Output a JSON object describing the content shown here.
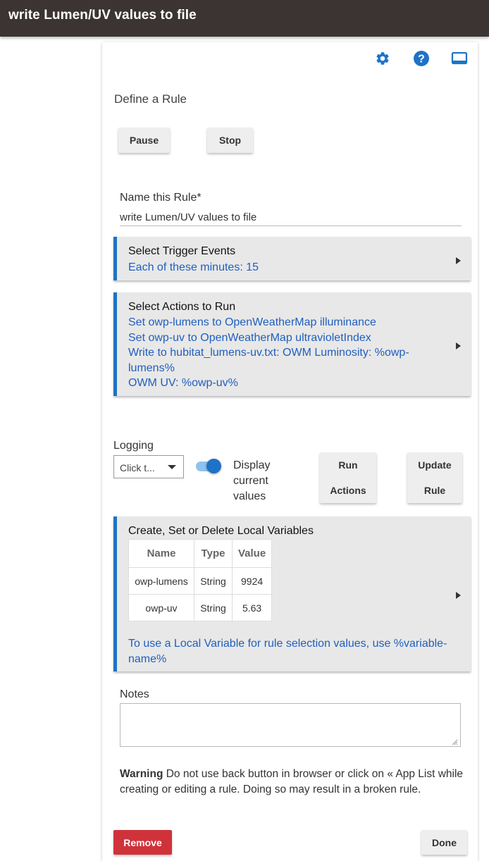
{
  "window": {
    "title": "write Lumen/UV values to file"
  },
  "toolbar": {
    "settings_icon": "gear-icon",
    "help_icon": "help-icon",
    "display_icon": "monitor-icon",
    "accent_color": "#1e73c6"
  },
  "page": {
    "heading": "Define a Rule"
  },
  "controls": {
    "pause_label": "Pause",
    "stop_label": "Stop"
  },
  "rule_name": {
    "label": "Name this Rule*",
    "value": "write Lumen/UV values to file"
  },
  "triggers": {
    "title": "Select Trigger Events",
    "lines": [
      "Each of these minutes: 15"
    ]
  },
  "actions": {
    "title": "Select Actions to Run",
    "lines": [
      "Set owp-lumens to OpenWeatherMap illuminance",
      "Set owp-uv to OpenWeatherMap ultravioletIndex",
      "Write to hubitat_lumens-uv.txt: OWM Luminosity: %owp-",
      "lumens%",
      "OWM UV: %owp-uv%"
    ]
  },
  "logging": {
    "label": "Logging",
    "select_value": "Click t...",
    "toggle_label_lines": [
      "Display",
      "current",
      "values"
    ],
    "toggle_on": true
  },
  "buttons": {
    "run_actions_lines": [
      "Run",
      "Actions"
    ],
    "update_rule_lines": [
      "Update",
      "Rule"
    ],
    "remove_label": "Remove",
    "done_label": "Done",
    "remove_color": "#d0323a"
  },
  "variables": {
    "title": "Create, Set or Delete Local Variables",
    "columns": [
      "Name",
      "Type",
      "Value"
    ],
    "rows": [
      [
        "owp-lumens",
        "String",
        "9924"
      ],
      [
        "owp-uv",
        "String",
        "5.63"
      ]
    ],
    "hint_lines": [
      "To use a Local Variable for rule selection values, use %variable-",
      "name%"
    ]
  },
  "notes": {
    "label": "Notes",
    "value": ""
  },
  "warning": {
    "bold": "Warning",
    "text": " Do not use back button in browser or click on « App List while creating or editing a rule. Doing so may result in a broken rule."
  }
}
